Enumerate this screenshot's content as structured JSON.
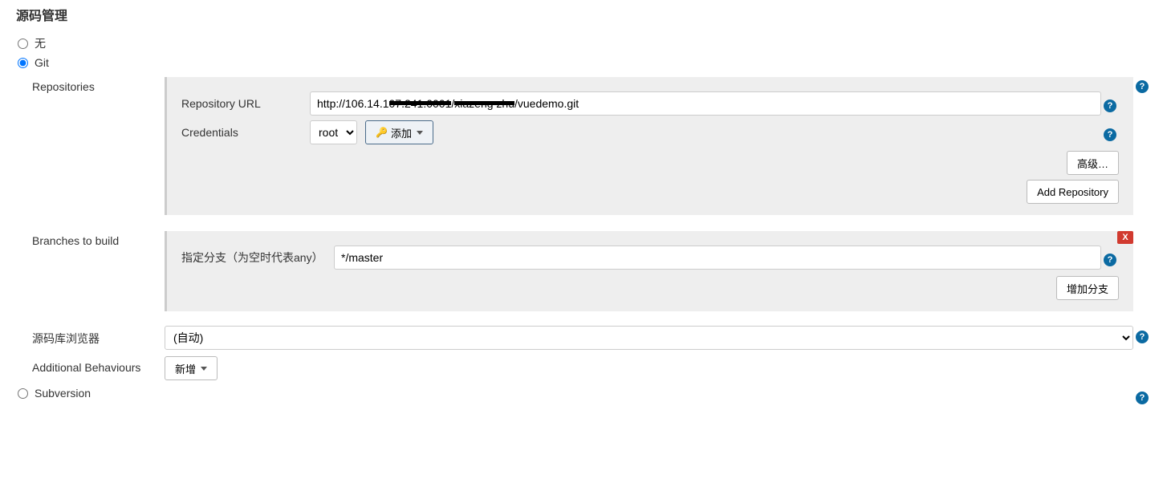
{
  "section_title": "源码管理",
  "scm": {
    "options": {
      "none": "无",
      "git": "Git",
      "subversion": "Subversion"
    },
    "selected": "git"
  },
  "repositories": {
    "label": "Repositories",
    "url_label": "Repository URL",
    "url_value_prefix": "http://106.14.1",
    "url_redacted_a": "07.241:0001",
    "url_value_mid": "/",
    "url_redacted_b": "xiazeng zhu",
    "url_value_suffix": "/vuedemo.git",
    "credentials_label": "Credentials",
    "credentials_value": "root",
    "add_label": "添加",
    "advanced_btn": "高级…",
    "add_repo_btn": "Add Repository"
  },
  "branches": {
    "label": "Branches to build",
    "specifier_label": "指定分支（为空时代表any）",
    "specifier_value": "*/master",
    "add_branch_btn": "增加分支",
    "delete_btn": "X"
  },
  "browser": {
    "label": "源码库浏览器",
    "value": "(自动)"
  },
  "additional": {
    "label": "Additional Behaviours",
    "add_btn": "新增"
  },
  "icons": {
    "help": "?"
  }
}
